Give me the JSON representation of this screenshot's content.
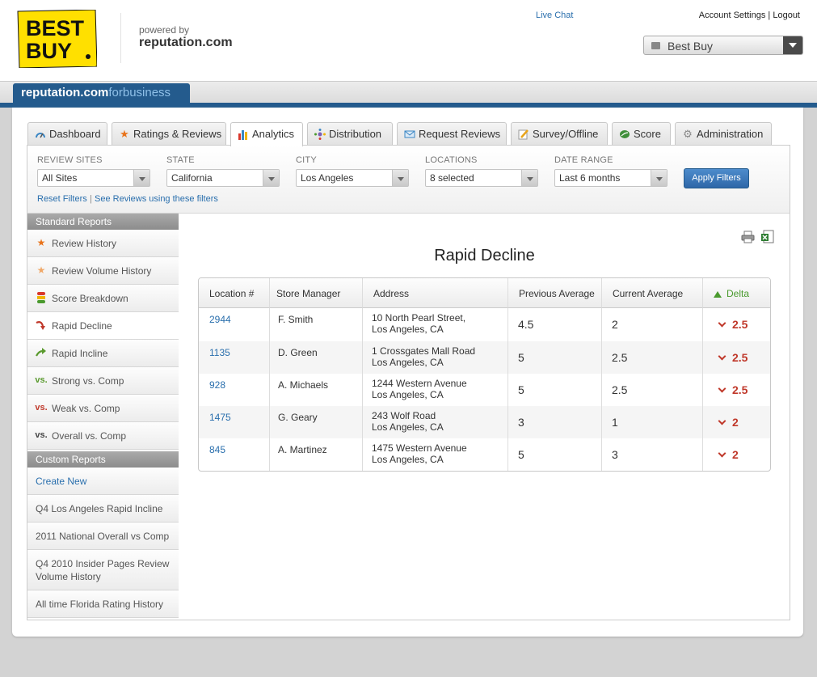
{
  "header": {
    "logo_text": [
      "BEST",
      "BUY"
    ],
    "powered_by": "powered by",
    "powered_brand": "reputation.com",
    "live_chat": "Live Chat",
    "account_settings": "Account Settings",
    "separator": "|",
    "logout": "Logout",
    "business_select": "Best Buy"
  },
  "brand_bar": {
    "main": "reputation.com",
    "suffix": "forbusiness"
  },
  "tabs": [
    {
      "label": "Dashboard",
      "icon": "dashboard-icon",
      "active": false
    },
    {
      "label": "Ratings & Reviews",
      "icon": "star-icon",
      "active": false
    },
    {
      "label": "Analytics",
      "icon": "bar-chart-icon",
      "active": true
    },
    {
      "label": "Distribution",
      "icon": "distribution-icon",
      "active": false
    },
    {
      "label": "Request Reviews",
      "icon": "envelope-icon",
      "active": false
    },
    {
      "label": "Survey/Offline",
      "icon": "pencil-icon",
      "active": false
    },
    {
      "label": "Score",
      "icon": "score-leaf-icon",
      "active": false
    },
    {
      "label": "Administration",
      "icon": "gear-icon",
      "active": false
    }
  ],
  "filters": {
    "review_sites": {
      "label": "REVIEW SITES",
      "value": "All Sites"
    },
    "state": {
      "label": "STATE",
      "value": "California"
    },
    "city": {
      "label": "CITY",
      "value": "Los Angeles"
    },
    "locations": {
      "label": "LOCATIONS",
      "value": "8 selected"
    },
    "date_range": {
      "label": "DATE RANGE",
      "value": "Last 6 months"
    },
    "apply": "Apply Filters",
    "reset": "Reset Filters",
    "link_sep": "|",
    "see_reviews": "See Reviews using these filters"
  },
  "sidebar": {
    "standard_header": "Standard Reports",
    "standard": [
      {
        "label": "Review History",
        "icon": "star-icon",
        "selected": false
      },
      {
        "label": "Review Volume History",
        "icon": "star-faded-icon",
        "selected": false
      },
      {
        "label": "Score Breakdown",
        "icon": "score-bars-icon",
        "selected": false
      },
      {
        "label": "Rapid Decline",
        "icon": "decline-arrow-icon",
        "selected": true
      },
      {
        "label": "Rapid Incline",
        "icon": "incline-arrow-icon",
        "selected": false
      },
      {
        "label": "Strong vs. Comp",
        "prefix": "vs.",
        "prefix_color": "#5a9a2e",
        "selected": false
      },
      {
        "label": "Weak vs. Comp",
        "prefix": "vs.",
        "prefix_color": "#c0392b",
        "selected": false
      },
      {
        "label": "Overall vs. Comp",
        "prefix": "vs.",
        "prefix_color": "#444444",
        "selected": false
      }
    ],
    "custom_header": "Custom Reports",
    "create_new": "Create New",
    "custom": [
      "Q4 Los Angeles Rapid Incline",
      "2011 National Overall vs Comp",
      "Q4 2010 Insider Pages Review Volume History",
      "All time Florida Rating History"
    ]
  },
  "report": {
    "title": "Rapid Decline",
    "columns": [
      "Location #",
      "Store Manager",
      "Address",
      "Previous Average",
      "Current Average",
      "Delta"
    ],
    "rows": [
      {
        "location": "2944",
        "manager": "F. Smith",
        "address1": "10 North Pearl Street,",
        "address2": "Los Angeles, CA",
        "previous": "4.5",
        "current": "2",
        "delta": "2.5"
      },
      {
        "location": "1135",
        "manager": "D. Green",
        "address1": "1 Crossgates Mall Road",
        "address2": "Los Angeles, CA",
        "previous": "5",
        "current": "2.5",
        "delta": "2.5"
      },
      {
        "location": "928",
        "manager": "A. Michaels",
        "address1": "1244 Western Avenue",
        "address2": "Los Angeles, CA",
        "previous": "5",
        "current": "2.5",
        "delta": "2.5"
      },
      {
        "location": "1475",
        "manager": "G. Geary",
        "address1": "243 Wolf Road",
        "address2": "Los Angeles, CA",
        "previous": "3",
        "current": "1",
        "delta": "2"
      },
      {
        "location": "845",
        "manager": "A. Martinez",
        "address1": "1475 Western Avenue",
        "address2": "Los Angeles, CA",
        "previous": "5",
        "current": "3",
        "delta": "2"
      }
    ]
  },
  "colors": {
    "brand_blue": "#245b8d",
    "link": "#2a6fad",
    "delta_red": "#c0392b",
    "sort_green": "#4a9a2e",
    "bestbuy_yellow": "#ffe000"
  }
}
